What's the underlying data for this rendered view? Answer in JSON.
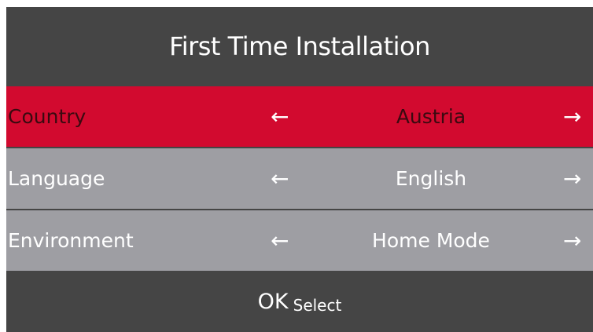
{
  "header": {
    "title": "First Time Installation"
  },
  "settings": [
    {
      "label": "Country",
      "value": "Austria",
      "selected": true
    },
    {
      "label": "Language",
      "value": "English",
      "selected": false
    },
    {
      "label": "Environment",
      "value": "Home Mode",
      "selected": false
    }
  ],
  "arrows": {
    "left": "←",
    "right": "→"
  },
  "footer": {
    "ok_key": "OK",
    "ok_action": "Select"
  },
  "colors": {
    "background": "#454545",
    "selected_row": "#d20a2f",
    "row": "#9e9ea3",
    "text": "#ffffff"
  }
}
